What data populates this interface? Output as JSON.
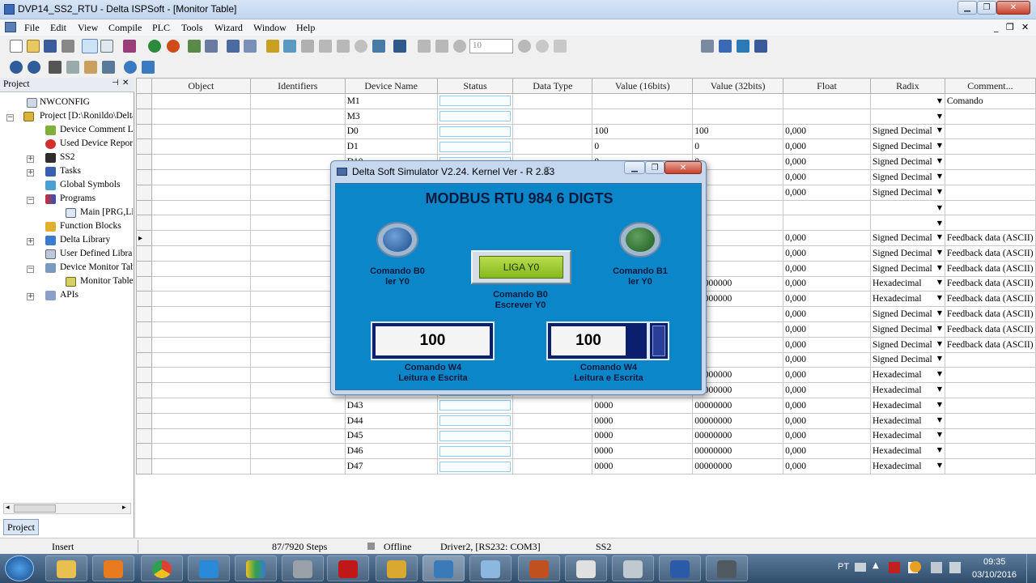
{
  "window": {
    "title": "DVP14_SS2_RTU - Delta ISPSoft - [Monitor Table]"
  },
  "menu": [
    "File",
    "Edit",
    "View",
    "Compile",
    "PLC",
    "Tools",
    "Wizard",
    "Window",
    "Help"
  ],
  "toolbar": {
    "step_value": "10"
  },
  "project_panel": {
    "title": "Project",
    "items": [
      "NWCONFIG",
      "Project [D:\\Ronildo\\Delta",
      "Device Comment List",
      "Used Device Report",
      "SS2",
      "Tasks",
      "Global Symbols",
      "Programs",
      "Main [PRG,LD]",
      "Function Blocks",
      "Delta Library",
      "User Defined Library",
      "Device Monitor Table",
      "Monitor Table",
      "APIs"
    ],
    "bottom_tab": "Project"
  },
  "table": {
    "headers": [
      "Object",
      "Identifiers",
      "Device Name",
      "Status",
      "Data Type",
      "Value (16bits)",
      "Value (32bits)",
      "Float",
      "Radix",
      "Comment..."
    ],
    "rows": [
      {
        "device": "M1",
        "v16": "",
        "v32": "",
        "float": "",
        "radix": "",
        "comment": "Comando"
      },
      {
        "device": "M3",
        "v16": "",
        "v32": "",
        "float": "",
        "radix": "",
        "comment": ""
      },
      {
        "device": "D0",
        "v16": "100",
        "v32": "100",
        "float": "0,000",
        "radix": "Signed Decimal",
        "comment": ""
      },
      {
        "device": "D1",
        "v16": "0",
        "v32": "0",
        "float": "0,000",
        "radix": "Signed Decimal",
        "comment": ""
      },
      {
        "device": "D10",
        "v16": "0",
        "v32": "0",
        "float": "0,000",
        "radix": "Signed Decimal",
        "comment": ""
      },
      {
        "device": "",
        "v16": "",
        "v32": "",
        "float": "0,000",
        "radix": "Signed Decimal",
        "comment": ""
      },
      {
        "device": "",
        "v16": "",
        "v32": "",
        "float": "0,000",
        "radix": "Signed Decimal",
        "comment": ""
      },
      {
        "device": "",
        "v16": "",
        "v32": "",
        "float": "",
        "radix": "",
        "comment": ""
      },
      {
        "device": "",
        "v16": "",
        "v32": "",
        "float": "",
        "radix": "",
        "comment": ""
      },
      {
        "device": "",
        "v16": "",
        "v32": "",
        "float": "0,000",
        "radix": "Signed Decimal",
        "comment": "Feedback data (ASCII)"
      },
      {
        "device": "",
        "v16": "",
        "v32": "",
        "float": "0,000",
        "radix": "Signed Decimal",
        "comment": "Feedback data (ASCII)"
      },
      {
        "device": "",
        "v16": "",
        "v32": "",
        "float": "0,000",
        "radix": "Signed Decimal",
        "comment": "Feedback data (ASCII)"
      },
      {
        "device": "",
        "v16": "",
        "v32": "00000000",
        "float": "0,000",
        "radix": "Hexadecimal",
        "comment": "Feedback data (ASCII)"
      },
      {
        "device": "",
        "v16": "",
        "v32": "00000000",
        "float": "0,000",
        "radix": "Hexadecimal",
        "comment": "Feedback data (ASCII)"
      },
      {
        "device": "",
        "v16": "",
        "v32": "",
        "float": "0,000",
        "radix": "Signed Decimal",
        "comment": "Feedback data (ASCII)"
      },
      {
        "device": "",
        "v16": "",
        "v32": "",
        "float": "0,000",
        "radix": "Signed Decimal",
        "comment": "Feedback data (ASCII)"
      },
      {
        "device": "",
        "v16": "",
        "v32": "",
        "float": "0,000",
        "radix": "Signed Decimal",
        "comment": "Feedback data (ASCII)"
      },
      {
        "device": "",
        "v16": "",
        "v32": "",
        "float": "0,000",
        "radix": "Signed Decimal",
        "comment": ""
      },
      {
        "device": "",
        "v16": "",
        "v32": "00000000",
        "float": "0,000",
        "radix": "Hexadecimal",
        "comment": ""
      },
      {
        "device": "",
        "v16": "",
        "v32": "00000000",
        "float": "0,000",
        "radix": "Hexadecimal",
        "comment": ""
      },
      {
        "device": "D43",
        "v16": "0000",
        "v32": "00000000",
        "float": "0,000",
        "radix": "Hexadecimal",
        "comment": ""
      },
      {
        "device": "D44",
        "v16": "0000",
        "v32": "00000000",
        "float": "0,000",
        "radix": "Hexadecimal",
        "comment": ""
      },
      {
        "device": "D45",
        "v16": "0000",
        "v32": "00000000",
        "float": "0,000",
        "radix": "Hexadecimal",
        "comment": ""
      },
      {
        "device": "D46",
        "v16": "0000",
        "v32": "00000000",
        "float": "0,000",
        "radix": "Hexadecimal",
        "comment": ""
      },
      {
        "device": "D47",
        "v16": "0000",
        "v32": "00000000",
        "float": "0,000",
        "radix": "Hexadecimal",
        "comment": ""
      }
    ]
  },
  "simulator": {
    "title": "Delta Soft Simulator V2.24. Kernel Ver - R 2.83",
    "heading": "MODBUS RTU 984 6 DIGTS",
    "lamp_b0_label": "Comando B0\nler Y0",
    "lamp_b1_label": "Comando B1\nler Y0",
    "button_label": "LIGA Y0",
    "button_caption": "Comando B0\nEscrever Y0",
    "w4_left_value": "100",
    "w4_right_value": "100",
    "w4_left_caption": "Comando W4\nLeitura e Escrita",
    "w4_right_caption": "Comando W4\nLeitura e Escrita",
    "lamp_b0_color": "#1e4f8f",
    "lamp_b1_color": "#1e5a1e"
  },
  "statusbar": {
    "mode": "Insert",
    "steps": "87/7920 Steps",
    "state": "Offline",
    "driver": "Driver2, [RS232: COM3]",
    "plc": "SS2"
  },
  "taskbar": {
    "lang": "PT",
    "time": "09:35",
    "date": "03/10/2016"
  }
}
